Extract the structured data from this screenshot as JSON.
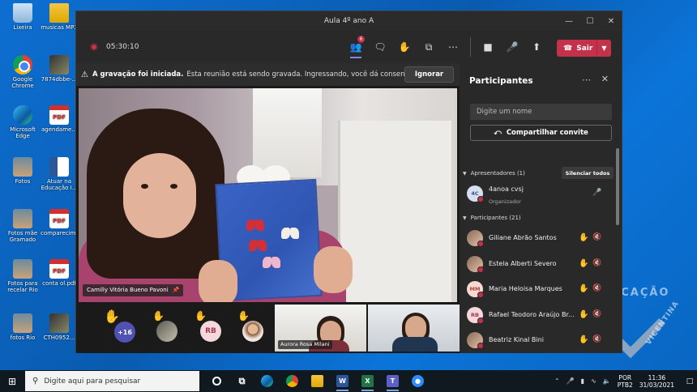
{
  "desktop": {
    "icons": [
      {
        "label": "Lixeira",
        "kind": "bin"
      },
      {
        "label": "musicas MP3",
        "kind": "folder"
      },
      {
        "label": "Google Chrome",
        "kind": "chrome"
      },
      {
        "label": "7874dbbe-...",
        "kind": "img2"
      },
      {
        "label": "Microsoft Edge",
        "kind": "edge"
      },
      {
        "label": "agendame...",
        "kind": "pdf"
      },
      {
        "label": "Fotos",
        "kind": "photo"
      },
      {
        "label": "Atuar na Educação I...",
        "kind": "word"
      },
      {
        "label": "Fotos mãe Gramado",
        "kind": "photo"
      },
      {
        "label": "comparecim...",
        "kind": "pdf"
      },
      {
        "label": "Fotos para recelar Rio",
        "kind": "photo"
      },
      {
        "label": "conta ol.pdf",
        "kind": "pdf"
      },
      {
        "label": "fotos Rio",
        "kind": "photo"
      },
      {
        "label": "CTH0952...",
        "kind": "img2"
      }
    ],
    "watermark": {
      "top": "EDUCAÇÃO",
      "side": "VICENTINA"
    }
  },
  "window": {
    "title": "Aula 4º ano A",
    "controls": {
      "minimize": "—",
      "maximize": "☐",
      "close": "✕"
    }
  },
  "toolbar": {
    "timer": "05:30:10",
    "participants_badge": "6",
    "leave_label": "Sair",
    "icons": [
      "participants-icon",
      "chat-icon",
      "reactions-icon",
      "rooms-icon",
      "more-icon",
      "camera-icon",
      "mic-icon",
      "share-icon"
    ]
  },
  "notice": {
    "bold": "A gravação foi iniciada.",
    "text": "Esta reunião está sendo gravada. Ingressando, você dá consentimen...",
    "button": "Ignorar"
  },
  "stage": {
    "main_name": "Camilly Vitória Bueno Pavoni",
    "overflow_count": "+16",
    "rb_initials": "RB",
    "tile1_name": "Aurora Rosa Milani"
  },
  "panel": {
    "title": "Participantes",
    "search_placeholder": "Digite um nome",
    "share_label": "Compartilhar convite",
    "presenters_label": "Apresentadores (1)",
    "mute_all_label": "Silenciar todos",
    "host": {
      "initials": "4C",
      "name": "4anoa cvsj",
      "role": "Organizador"
    },
    "participants_label": "Participantes (21)",
    "participants": [
      {
        "initials": "",
        "name": "Giliane Abrão Santos",
        "avatar": "photo"
      },
      {
        "initials": "",
        "name": "Estela Alberti Severo",
        "avatar": "photo"
      },
      {
        "initials": "MM",
        "name": "Maria Heloisa Marques",
        "avatar": "mm"
      },
      {
        "initials": "RB",
        "name": "Rafael Teodoro Araújo Br...",
        "avatar": "rb"
      },
      {
        "initials": "",
        "name": "Beatriz Kinal Bini",
        "avatar": "photo"
      }
    ]
  },
  "taskbar": {
    "search_placeholder": "Digite aqui para pesquisar",
    "lang_top": "POR",
    "lang_bottom": "PTB2",
    "time": "11:36",
    "date": "31/03/2021"
  }
}
